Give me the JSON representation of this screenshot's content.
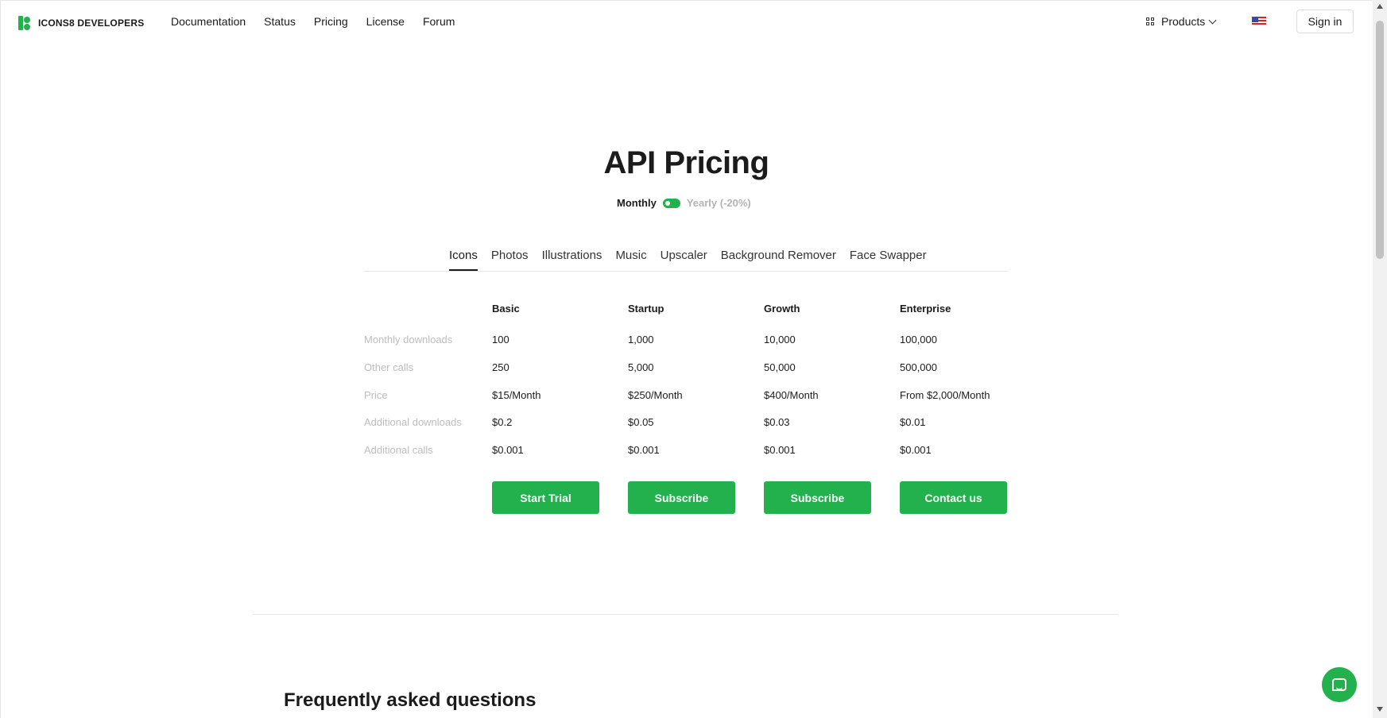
{
  "header": {
    "brand": "ICONS8 DEVELOPERS",
    "nav": [
      "Documentation",
      "Status",
      "Pricing",
      "License",
      "Forum"
    ],
    "products_label": "Products",
    "signin_label": "Sign in"
  },
  "hero": {
    "title": "API Pricing",
    "billing_monthly": "Monthly",
    "billing_yearly": "Yearly (-20%)"
  },
  "tabs": [
    "Icons",
    "Photos",
    "Illustrations",
    "Music",
    "Upscaler",
    "Background Remover",
    "Face Swapper"
  ],
  "active_tab": "Icons",
  "plans": [
    "Basic",
    "Startup",
    "Growth",
    "Enterprise"
  ],
  "rows": [
    {
      "label": "Monthly downloads",
      "values": [
        "100",
        "1,000",
        "10,000",
        "100,000"
      ]
    },
    {
      "label": "Other calls",
      "values": [
        "250",
        "5,000",
        "50,000",
        "500,000"
      ]
    },
    {
      "label": "Price",
      "values": [
        "$15/Month",
        "$250/Month",
        "$400/Month",
        "From $2,000/Month"
      ]
    },
    {
      "label": "Additional downloads",
      "values": [
        "$0.2",
        "$0.05",
        "$0.03",
        "$0.01"
      ]
    },
    {
      "label": "Additional calls",
      "values": [
        "$0.001",
        "$0.001",
        "$0.001",
        "$0.001"
      ]
    }
  ],
  "actions": [
    "Start Trial",
    "Subscribe",
    "Subscribe",
    "Contact us"
  ],
  "faq_title": "Frequently asked questions",
  "colors": {
    "accent": "#22b14c",
    "text": "#1b1b1b",
    "muted": "#bdbdbd"
  },
  "icons": {
    "logo": "icons8-logo-icon",
    "products": "grid-icon",
    "chevron": "chevron-down-icon",
    "flag": "us-flag-icon",
    "chat": "chat-icon"
  }
}
